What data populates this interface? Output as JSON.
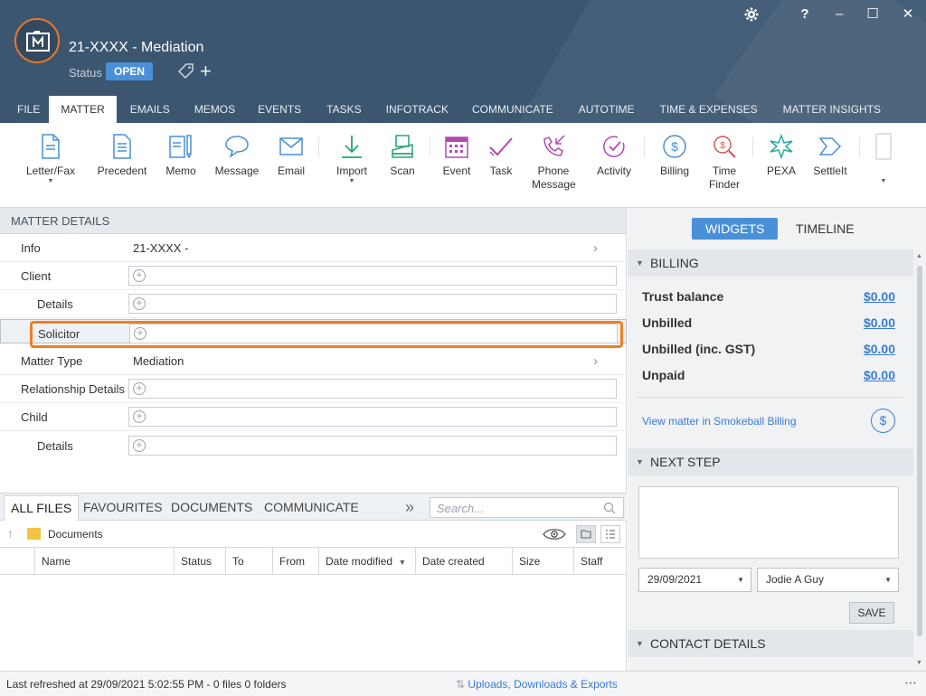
{
  "header": {
    "title": "21-XXXX - Mediation",
    "status_label": "Status",
    "status_value": "OPEN",
    "add_symbol": "+",
    "window_buttons": {
      "help": "?",
      "minimize": "–",
      "maximize": "☐",
      "close": "✕"
    }
  },
  "tabs": [
    "FILE",
    "MATTER",
    "EMAILS",
    "MEMOS",
    "EVENTS",
    "TASKS",
    "INFOTRACK",
    "COMMUNICATE",
    "AUTOTIME",
    "TIME & EXPENSES",
    "MATTER INSIGHTS"
  ],
  "active_tab": "MATTER",
  "ribbon": {
    "letter_fax": "Letter/Fax",
    "precedent": "Precedent",
    "memo": "Memo",
    "message": "Message",
    "email": "Email",
    "import": "Import",
    "scan": "Scan",
    "event": "Event",
    "task": "Task",
    "phone_message": [
      "Phone",
      "Message"
    ],
    "activity": "Activity",
    "billing": "Billing",
    "time_finder": [
      "Time",
      "Finder"
    ],
    "pexa": "PEXA",
    "settleit": "SettleIt"
  },
  "matter_details": {
    "header": "MATTER DETAILS",
    "info_label": "Info",
    "info_value": "21-XXXX -",
    "client_label": "Client",
    "client_details_label": "Details",
    "solicitor_label": "Solicitor",
    "matter_type_label": "Matter Type",
    "matter_type_value": "Mediation",
    "relationship_label": "Relationship Details",
    "child_label": "Child",
    "child_details_label": "Details"
  },
  "files": {
    "tabs": [
      "ALL FILES",
      "FAVOURITES",
      "DOCUMENTS",
      "COMMUNICATE"
    ],
    "search_placeholder": "Search...",
    "folder": "Documents",
    "columns": [
      "Name",
      "Status",
      "To",
      "From",
      "Date modified",
      "Date created",
      "Size",
      "Staff"
    ]
  },
  "footer": {
    "refresh": "Last refreshed at 29/09/2021 5:02:55 PM  -  0 files  0 folders",
    "uploads": "Uploads, Downloads & Exports"
  },
  "right_panel": {
    "tabs": [
      "WIDGETS",
      "TIMELINE"
    ],
    "billing_header": "BILLING",
    "billing_rows": [
      {
        "label": "Trust balance",
        "value": "$0.00"
      },
      {
        "label": "Unbilled",
        "value": "$0.00"
      },
      {
        "label": "Unbilled (inc. GST)",
        "value": "$0.00"
      },
      {
        "label": "Unpaid",
        "value": "$0.00"
      }
    ],
    "billing_link": "View matter in Smokeball Billing",
    "next_step_header": "NEXT STEP",
    "date_value": "29/09/2021",
    "staff_value": "Jodie A Guy",
    "save_label": "SAVE",
    "contact_header": "CONTACT DETAILS"
  },
  "colors": {
    "header_bg": "#3c5670",
    "accent": "#4a90d9",
    "highlight": "#f07f1f",
    "ribbon_icon": "#4a8fd6",
    "ribbon_icon_green": "#27a374",
    "ribbon_icon_purple": "#b04ab0"
  }
}
